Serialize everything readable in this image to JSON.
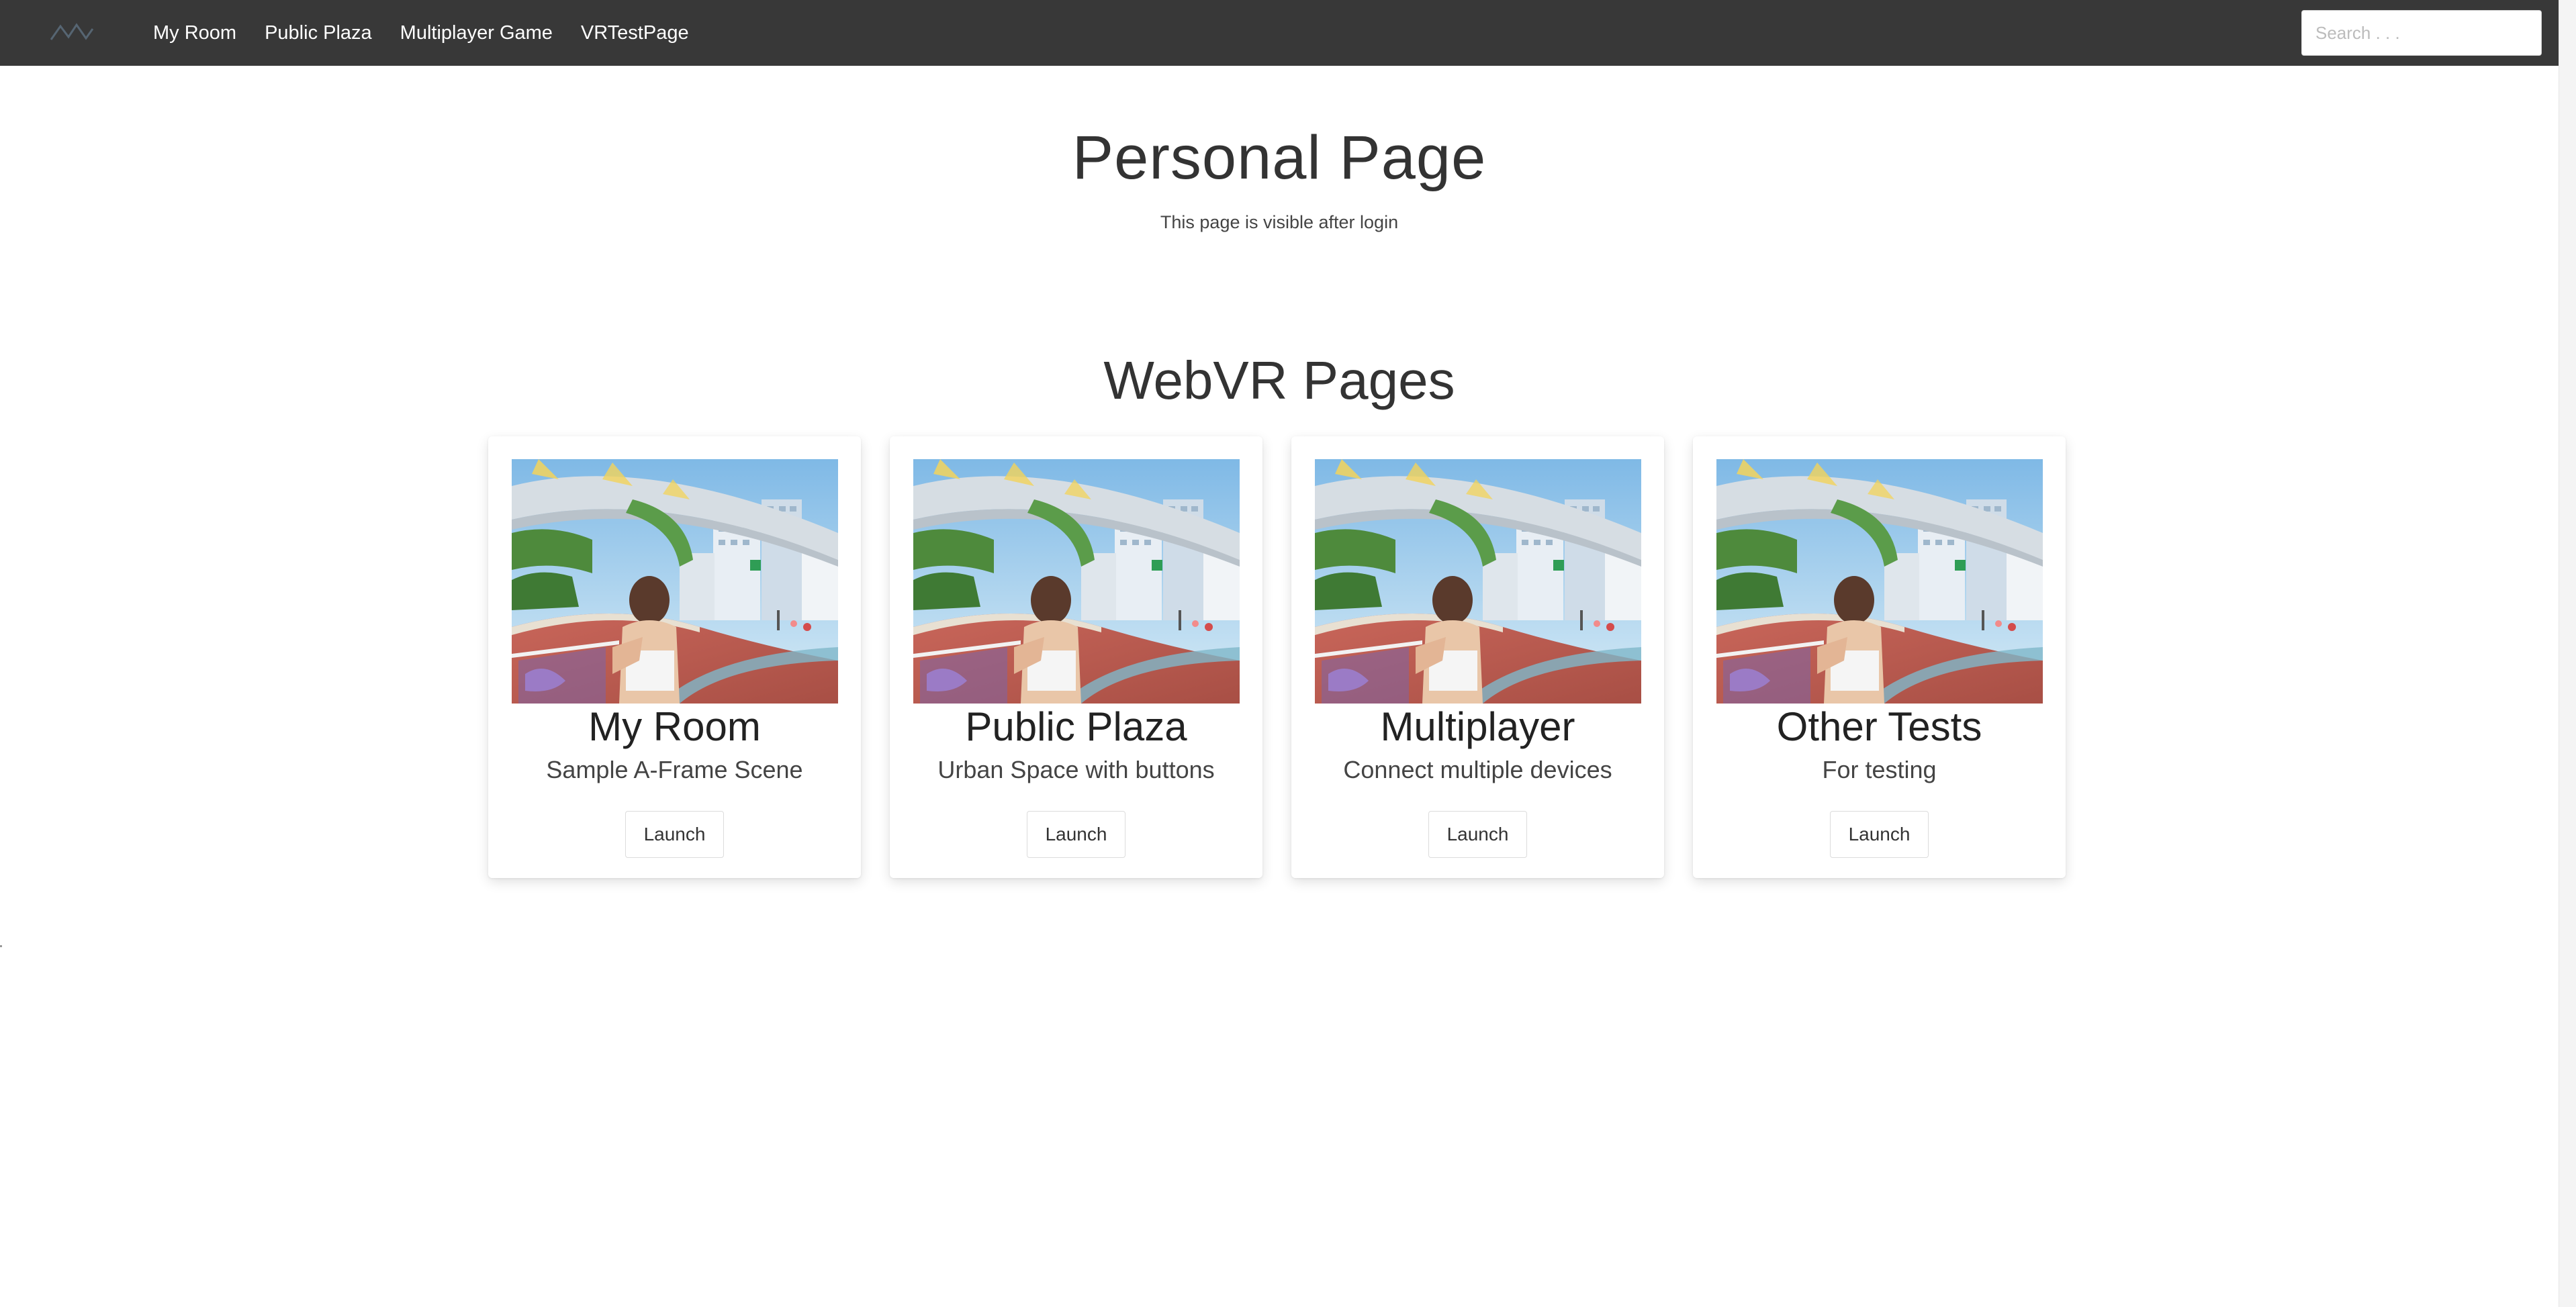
{
  "navbar": {
    "links": [
      "My Room",
      "Public Plaza",
      "Multiplayer Game",
      "VRTestPage"
    ],
    "search_placeholder": "Search . . .",
    "background": "#383838"
  },
  "header": {
    "title": "Personal Page",
    "subtitle": "This page is visible after login"
  },
  "section": {
    "title": "WebVR Pages"
  },
  "cards": [
    {
      "title": "My Room",
      "description": "Sample A-Frame Scene",
      "button": "Launch",
      "image": "city-plaza-photo"
    },
    {
      "title": "Public Plaza",
      "description": "Urban Space with buttons",
      "button": "Launch",
      "image": "city-plaza-photo"
    },
    {
      "title": "Multiplayer",
      "description": "Connect multiple devices",
      "button": "Launch",
      "image": "city-plaza-photo"
    },
    {
      "title": "Other Tests",
      "description": "For testing",
      "button": "Launch",
      "image": "city-plaza-photo"
    }
  ]
}
